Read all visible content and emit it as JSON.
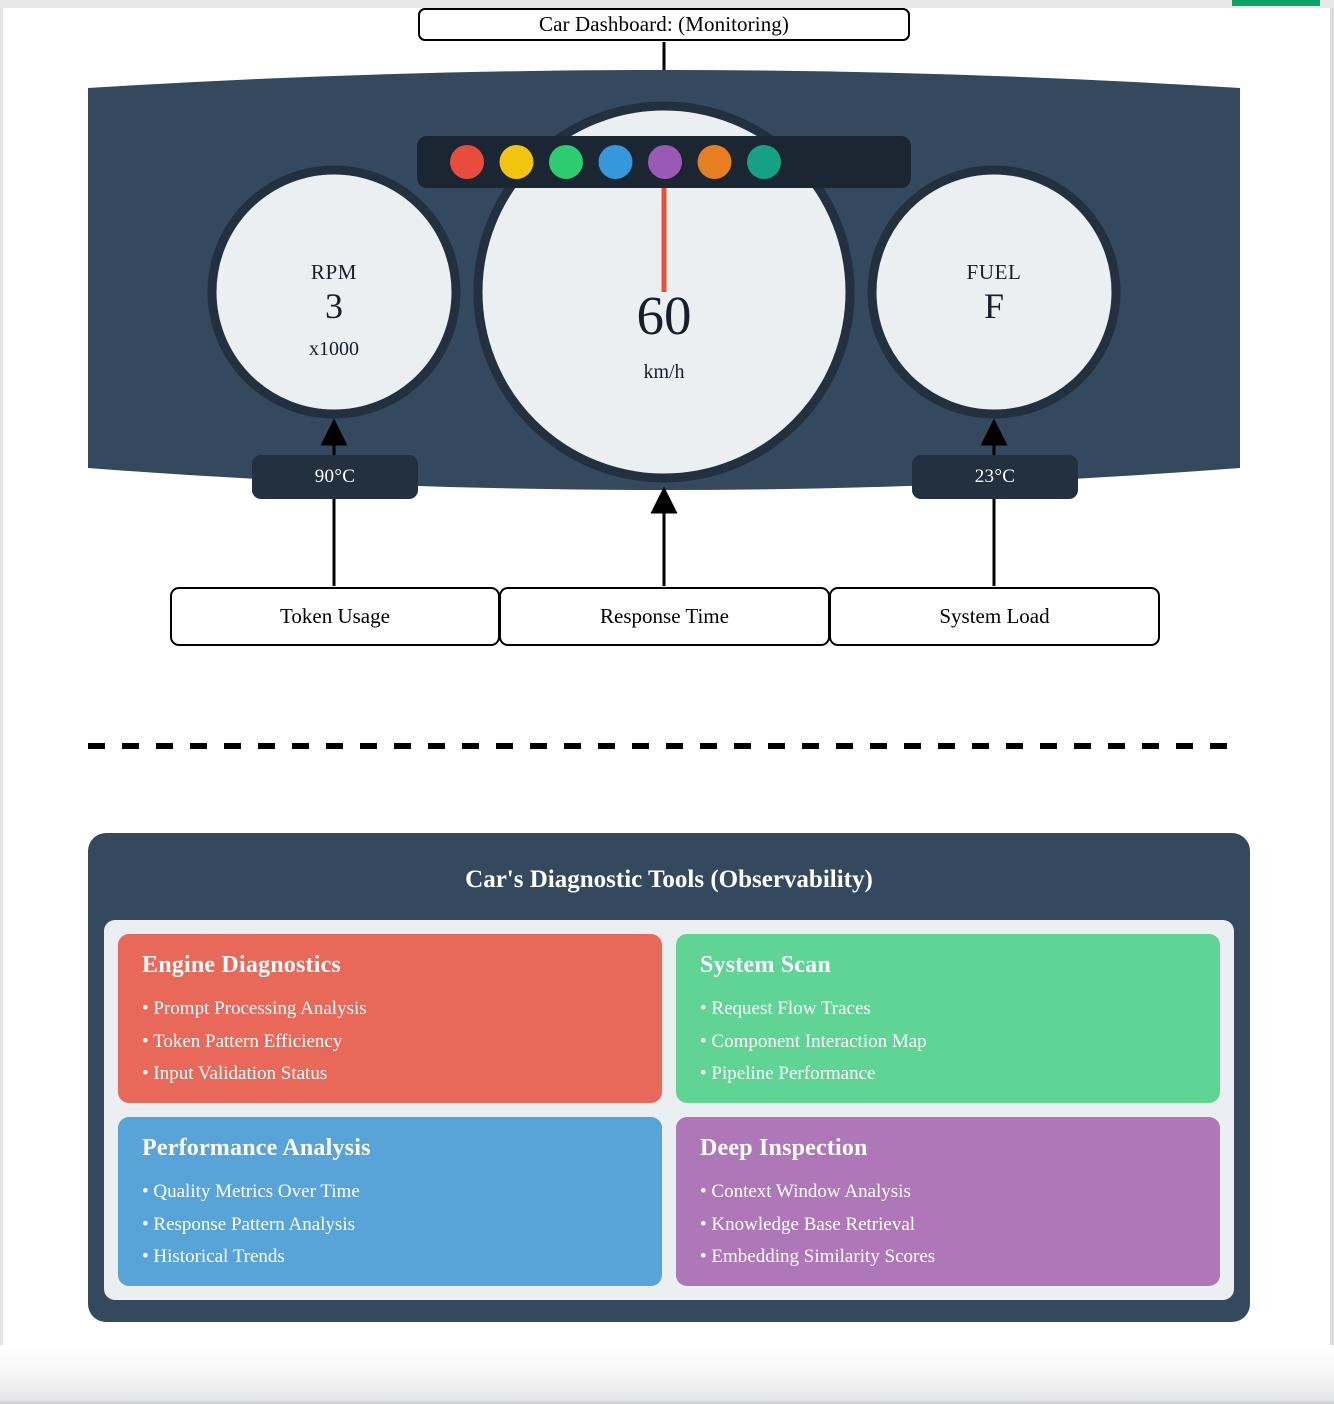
{
  "page": {
    "accent_color": "#0ca06a",
    "dashboard_body_color": "#34495e",
    "gauge_face_color": "#eceff1",
    "gauge_rim_color": "#22303f",
    "needle_color": "#e8503a"
  },
  "title": {
    "text": "Car Dashboard: (Monitoring)"
  },
  "dashboard": {
    "indicator_lights": [
      {
        "name": "light-red",
        "color": "#e74c3c"
      },
      {
        "name": "light-yellow",
        "color": "#f1c40f"
      },
      {
        "name": "light-green",
        "color": "#2ecc71"
      },
      {
        "name": "light-blue",
        "color": "#3498db"
      },
      {
        "name": "light-purple",
        "color": "#9b59b6"
      },
      {
        "name": "light-orange",
        "color": "#e67e22"
      },
      {
        "name": "light-teal",
        "color": "#16a085"
      }
    ],
    "gauges": [
      {
        "id": "rpm",
        "label": "RPM",
        "value": "3",
        "unit": "x1000"
      },
      {
        "id": "speed",
        "label": "",
        "value": "60",
        "unit": "km/h"
      },
      {
        "id": "fuel",
        "label": "FUEL",
        "value": "F",
        "unit": ""
      }
    ],
    "temperatures": [
      {
        "id": "engine-temp",
        "text": "90°C"
      },
      {
        "id": "cabin-temp",
        "text": "23°C"
      }
    ]
  },
  "metrics": [
    {
      "id": "token-usage",
      "label": "Token Usage"
    },
    {
      "id": "response-time",
      "label": "Response Time"
    },
    {
      "id": "system-load",
      "label": "System Load"
    }
  ],
  "diagnostics": {
    "header": "Car's Diagnostic Tools (Observability)",
    "cards": [
      {
        "id": "engine-diagnostics",
        "title": "Engine Diagnostics",
        "color": "#e8685a",
        "items": [
          "• Prompt Processing Analysis",
          "• Token Pattern Efficiency",
          "• Input Validation Status"
        ]
      },
      {
        "id": "system-scan",
        "title": "System Scan",
        "color": "#5fd494",
        "items": [
          "• Request Flow Traces",
          "• Component Interaction Map",
          "• Pipeline Performance"
        ]
      },
      {
        "id": "performance-analysis",
        "title": "Performance Analysis",
        "color": "#58a4d8",
        "items": [
          "• Quality Metrics Over Time",
          "• Response Pattern Analysis",
          "• Historical Trends"
        ]
      },
      {
        "id": "deep-inspection",
        "title": "Deep Inspection",
        "color": "#ae78b8",
        "items": [
          "• Context Window Analysis",
          "• Knowledge Base Retrieval",
          "• Embedding Similarity Scores"
        ]
      }
    ]
  }
}
